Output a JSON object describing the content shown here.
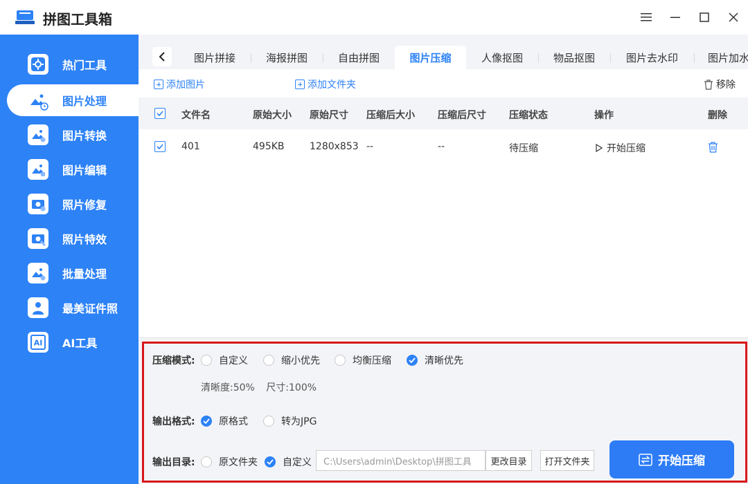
{
  "app": {
    "title": "拼图工具箱"
  },
  "sidebar": {
    "items": [
      {
        "label": "热门工具",
        "icon": "gear-icon"
      },
      {
        "label": "图片处理",
        "icon": "image-clock-icon",
        "active": true
      },
      {
        "label": "图片转换",
        "icon": "image-convert-icon"
      },
      {
        "label": "图片编辑",
        "icon": "image-edit-icon"
      },
      {
        "label": "照片修复",
        "icon": "camera-plus-icon"
      },
      {
        "label": "照片特效",
        "icon": "camera-wand-icon"
      },
      {
        "label": "批量处理",
        "icon": "image-batch-icon"
      },
      {
        "label": "最美证件照",
        "icon": "person-icon"
      },
      {
        "label": "AI工具",
        "icon": "ai-icon"
      }
    ]
  },
  "tabs": [
    "图片拼接",
    "海报拼图",
    "自由拼图",
    "图片压缩",
    "人像抠图",
    "物品抠图",
    "图片去水印",
    "图片加水"
  ],
  "active_tab": "图片压缩",
  "toolbar": {
    "add_image": "添加图片",
    "add_folder": "添加文件夹",
    "remove": "移除"
  },
  "table": {
    "headers": [
      "文件名",
      "原始大小",
      "原始尺寸",
      "压缩后大小",
      "压缩后尺寸",
      "压缩状态",
      "操作",
      "删除"
    ],
    "rows": [
      {
        "name": "401",
        "orig_size": "495KB",
        "orig_dim": "1280x853",
        "new_size": "--",
        "new_dim": "--",
        "status": "待压缩",
        "action": "开始压缩"
      }
    ]
  },
  "settings": {
    "mode_label": "压缩模式:",
    "modes": [
      "自定义",
      "缩小优先",
      "均衡压缩",
      "清晰优先"
    ],
    "selected_mode": "清晰优先",
    "quality_text": "清晰度:50%",
    "size_text": "尺寸:100%",
    "format_label": "输出格式:",
    "formats": [
      "原格式",
      "转为JPG"
    ],
    "selected_format": "原格式",
    "dir_label": "输出目录:",
    "dirs": [
      "原文件夹",
      "自定义"
    ],
    "selected_dir": "自定义",
    "dir_path": "C:\\Users\\admin\\Desktop\\拼图工具",
    "change_dir": "更改目录",
    "open_folder": "打开文件夹",
    "start_button": "开始压缩"
  },
  "colors": {
    "accent": "#2d82f6",
    "highlight_border": "#d9161b"
  }
}
